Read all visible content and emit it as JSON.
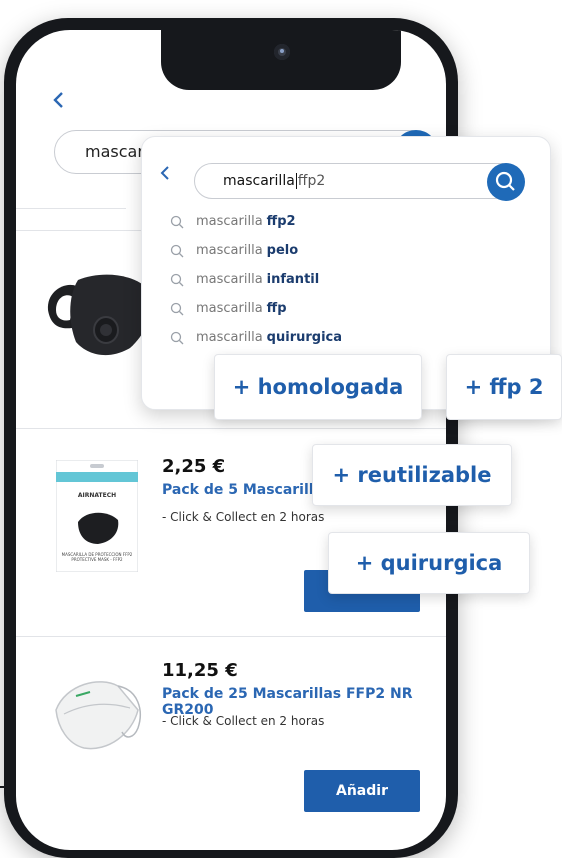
{
  "main": {
    "back_icon": "chevron-left-icon",
    "search_value": "mascarilla",
    "products": [
      {
        "price": "2,25 €",
        "name": "Pack de 5 Mascarillas",
        "note": "- Click & Collect en 2 horas"
      },
      {
        "price": "11,25 €",
        "name": "Pack de 25 Mascarillas FFP2 NR GR200",
        "note": "- Click & Collect en 2 horas",
        "add_label": "Añadir"
      }
    ],
    "package_text": {
      "brand": "AIRNATECH",
      "line1": "MASCARILLA DE PROTECCION FFP2",
      "line2": "PROTECTIVE MASK - FFP2"
    }
  },
  "panel": {
    "back_icon": "chevron-left-icon",
    "search_typed": "mascarilla",
    "search_completion": "ffp2",
    "suggestions": [
      {
        "prefix": "mascarilla",
        "completion": "ffp2"
      },
      {
        "prefix": "mascarilla",
        "completion": "pelo"
      },
      {
        "prefix": "mascarilla",
        "completion": "infantil"
      },
      {
        "prefix": "mascarilla",
        "completion": "ffp"
      },
      {
        "prefix": "mascarilla",
        "completion": "quirurgica"
      }
    ]
  },
  "chips": {
    "homologada": "+ homologada",
    "ffp2": "+ ffp 2",
    "reutilizable": "+ reutilizable",
    "quirurgica": "+ quirurgica"
  },
  "colors": {
    "accent": "#1f5eab",
    "link": "#2b67b3",
    "frame": "#16181c"
  }
}
